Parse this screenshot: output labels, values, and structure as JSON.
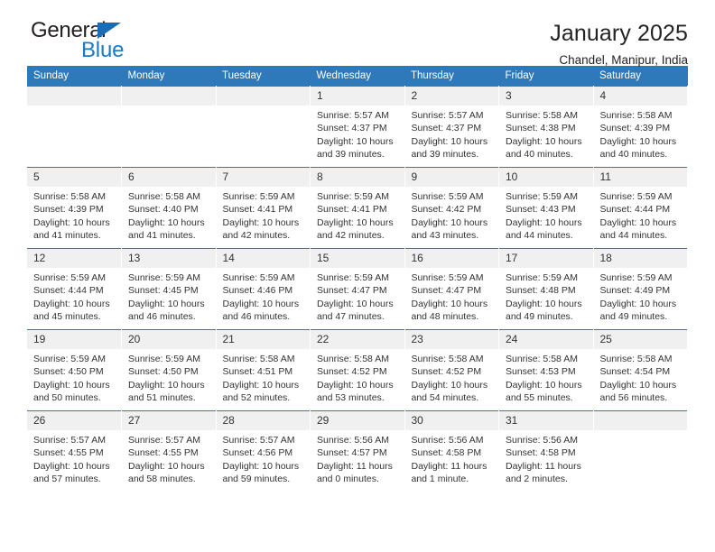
{
  "brand": {
    "name_top": "General",
    "name_bottom": "Blue",
    "accent_color": "#1a7ac4",
    "triangle_color": "#1a6cb5"
  },
  "header": {
    "title": "January 2025",
    "subtitle": "Chandel, Manipur, India"
  },
  "calendar": {
    "header_bg": "#2e79b9",
    "daynum_bg": "#f0f0f0",
    "weekdays": [
      "Sunday",
      "Monday",
      "Tuesday",
      "Wednesday",
      "Thursday",
      "Friday",
      "Saturday"
    ],
    "weeks": [
      [
        {
          "day": "",
          "lines": []
        },
        {
          "day": "",
          "lines": []
        },
        {
          "day": "",
          "lines": []
        },
        {
          "day": "1",
          "lines": [
            "Sunrise: 5:57 AM",
            "Sunset: 4:37 PM",
            "Daylight: 10 hours",
            "and 39 minutes."
          ]
        },
        {
          "day": "2",
          "lines": [
            "Sunrise: 5:57 AM",
            "Sunset: 4:37 PM",
            "Daylight: 10 hours",
            "and 39 minutes."
          ]
        },
        {
          "day": "3",
          "lines": [
            "Sunrise: 5:58 AM",
            "Sunset: 4:38 PM",
            "Daylight: 10 hours",
            "and 40 minutes."
          ]
        },
        {
          "day": "4",
          "lines": [
            "Sunrise: 5:58 AM",
            "Sunset: 4:39 PM",
            "Daylight: 10 hours",
            "and 40 minutes."
          ]
        }
      ],
      [
        {
          "day": "5",
          "lines": [
            "Sunrise: 5:58 AM",
            "Sunset: 4:39 PM",
            "Daylight: 10 hours",
            "and 41 minutes."
          ]
        },
        {
          "day": "6",
          "lines": [
            "Sunrise: 5:58 AM",
            "Sunset: 4:40 PM",
            "Daylight: 10 hours",
            "and 41 minutes."
          ]
        },
        {
          "day": "7",
          "lines": [
            "Sunrise: 5:59 AM",
            "Sunset: 4:41 PM",
            "Daylight: 10 hours",
            "and 42 minutes."
          ]
        },
        {
          "day": "8",
          "lines": [
            "Sunrise: 5:59 AM",
            "Sunset: 4:41 PM",
            "Daylight: 10 hours",
            "and 42 minutes."
          ]
        },
        {
          "day": "9",
          "lines": [
            "Sunrise: 5:59 AM",
            "Sunset: 4:42 PM",
            "Daylight: 10 hours",
            "and 43 minutes."
          ]
        },
        {
          "day": "10",
          "lines": [
            "Sunrise: 5:59 AM",
            "Sunset: 4:43 PM",
            "Daylight: 10 hours",
            "and 44 minutes."
          ]
        },
        {
          "day": "11",
          "lines": [
            "Sunrise: 5:59 AM",
            "Sunset: 4:44 PM",
            "Daylight: 10 hours",
            "and 44 minutes."
          ]
        }
      ],
      [
        {
          "day": "12",
          "lines": [
            "Sunrise: 5:59 AM",
            "Sunset: 4:44 PM",
            "Daylight: 10 hours",
            "and 45 minutes."
          ]
        },
        {
          "day": "13",
          "lines": [
            "Sunrise: 5:59 AM",
            "Sunset: 4:45 PM",
            "Daylight: 10 hours",
            "and 46 minutes."
          ]
        },
        {
          "day": "14",
          "lines": [
            "Sunrise: 5:59 AM",
            "Sunset: 4:46 PM",
            "Daylight: 10 hours",
            "and 46 minutes."
          ]
        },
        {
          "day": "15",
          "lines": [
            "Sunrise: 5:59 AM",
            "Sunset: 4:47 PM",
            "Daylight: 10 hours",
            "and 47 minutes."
          ]
        },
        {
          "day": "16",
          "lines": [
            "Sunrise: 5:59 AM",
            "Sunset: 4:47 PM",
            "Daylight: 10 hours",
            "and 48 minutes."
          ]
        },
        {
          "day": "17",
          "lines": [
            "Sunrise: 5:59 AM",
            "Sunset: 4:48 PM",
            "Daylight: 10 hours",
            "and 49 minutes."
          ]
        },
        {
          "day": "18",
          "lines": [
            "Sunrise: 5:59 AM",
            "Sunset: 4:49 PM",
            "Daylight: 10 hours",
            "and 49 minutes."
          ]
        }
      ],
      [
        {
          "day": "19",
          "lines": [
            "Sunrise: 5:59 AM",
            "Sunset: 4:50 PM",
            "Daylight: 10 hours",
            "and 50 minutes."
          ]
        },
        {
          "day": "20",
          "lines": [
            "Sunrise: 5:59 AM",
            "Sunset: 4:50 PM",
            "Daylight: 10 hours",
            "and 51 minutes."
          ]
        },
        {
          "day": "21",
          "lines": [
            "Sunrise: 5:58 AM",
            "Sunset: 4:51 PM",
            "Daylight: 10 hours",
            "and 52 minutes."
          ]
        },
        {
          "day": "22",
          "lines": [
            "Sunrise: 5:58 AM",
            "Sunset: 4:52 PM",
            "Daylight: 10 hours",
            "and 53 minutes."
          ]
        },
        {
          "day": "23",
          "lines": [
            "Sunrise: 5:58 AM",
            "Sunset: 4:52 PM",
            "Daylight: 10 hours",
            "and 54 minutes."
          ]
        },
        {
          "day": "24",
          "lines": [
            "Sunrise: 5:58 AM",
            "Sunset: 4:53 PM",
            "Daylight: 10 hours",
            "and 55 minutes."
          ]
        },
        {
          "day": "25",
          "lines": [
            "Sunrise: 5:58 AM",
            "Sunset: 4:54 PM",
            "Daylight: 10 hours",
            "and 56 minutes."
          ]
        }
      ],
      [
        {
          "day": "26",
          "lines": [
            "Sunrise: 5:57 AM",
            "Sunset: 4:55 PM",
            "Daylight: 10 hours",
            "and 57 minutes."
          ]
        },
        {
          "day": "27",
          "lines": [
            "Sunrise: 5:57 AM",
            "Sunset: 4:55 PM",
            "Daylight: 10 hours",
            "and 58 minutes."
          ]
        },
        {
          "day": "28",
          "lines": [
            "Sunrise: 5:57 AM",
            "Sunset: 4:56 PM",
            "Daylight: 10 hours",
            "and 59 minutes."
          ]
        },
        {
          "day": "29",
          "lines": [
            "Sunrise: 5:56 AM",
            "Sunset: 4:57 PM",
            "Daylight: 11 hours",
            "and 0 minutes."
          ]
        },
        {
          "day": "30",
          "lines": [
            "Sunrise: 5:56 AM",
            "Sunset: 4:58 PM",
            "Daylight: 11 hours",
            "and 1 minute."
          ]
        },
        {
          "day": "31",
          "lines": [
            "Sunrise: 5:56 AM",
            "Sunset: 4:58 PM",
            "Daylight: 11 hours",
            "and 2 minutes."
          ]
        },
        {
          "day": "",
          "lines": []
        }
      ]
    ]
  }
}
